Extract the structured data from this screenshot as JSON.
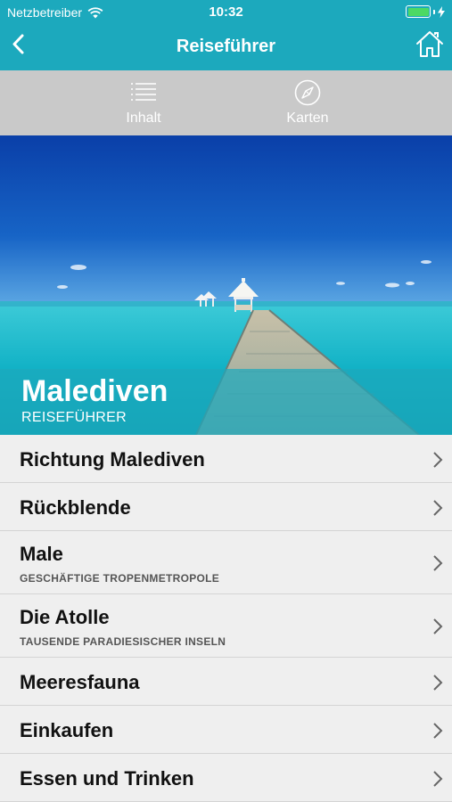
{
  "status_bar": {
    "carrier": "Netzbetreiber",
    "time": "10:32",
    "wifi_icon": "wifi-icon",
    "battery_icon": "battery-icon",
    "charging_icon": "bolt-icon"
  },
  "nav": {
    "title": "Reiseführer",
    "back_icon": "chevron-left-icon",
    "home_icon": "home-icon"
  },
  "toolbar": {
    "items": [
      {
        "label": "Inhalt",
        "icon": "list-icon"
      },
      {
        "label": "Karten",
        "icon": "compass-icon"
      }
    ]
  },
  "hero": {
    "title": "Malediven",
    "subtitle": "REISEFÜHRER"
  },
  "list": {
    "items": [
      {
        "title": "Richtung Malediven",
        "subtitle": ""
      },
      {
        "title": "Rückblende",
        "subtitle": ""
      },
      {
        "title": "Male",
        "subtitle": "GESCHÄFTIGE TROPENMETROPOLE"
      },
      {
        "title": "Die Atolle",
        "subtitle": "TAUSENDE PARADIESISCHER INSELN"
      },
      {
        "title": "Meeresfauna",
        "subtitle": ""
      },
      {
        "title": "Einkaufen",
        "subtitle": ""
      },
      {
        "title": "Essen und Trinken",
        "subtitle": ""
      }
    ]
  },
  "colors": {
    "accent": "#1ca9bd",
    "toolbar": "#c9c9c9",
    "list_bg": "#efefef",
    "battery": "#4cd964"
  }
}
